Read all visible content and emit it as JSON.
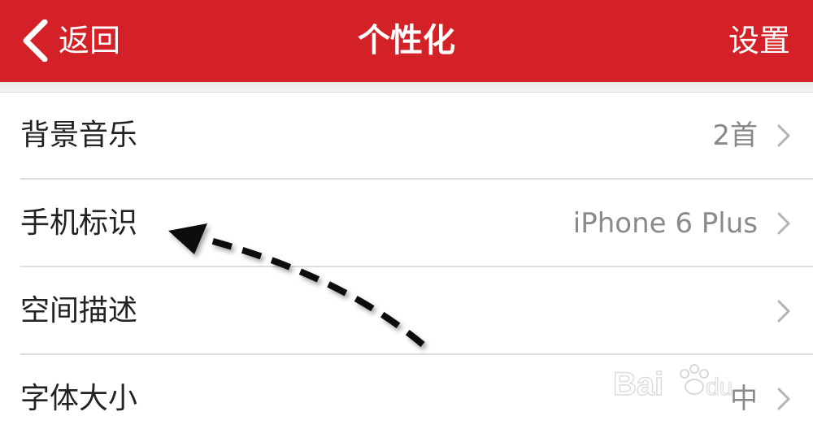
{
  "navbar": {
    "back_label": "返回",
    "title": "个性化",
    "right_label": "设置",
    "color": "#d42127"
  },
  "list": {
    "items": [
      {
        "label": "背景音乐",
        "value": "2首"
      },
      {
        "label": "手机标识",
        "value": "iPhone 6 Plus"
      },
      {
        "label": "空间描述",
        "value": ""
      },
      {
        "label": "字体大小",
        "value": "中"
      }
    ]
  },
  "icons": {
    "back": "chevron-left-icon",
    "row_disclosure": "chevron-right-icon",
    "annotation": "dashed-arrow-icon"
  }
}
